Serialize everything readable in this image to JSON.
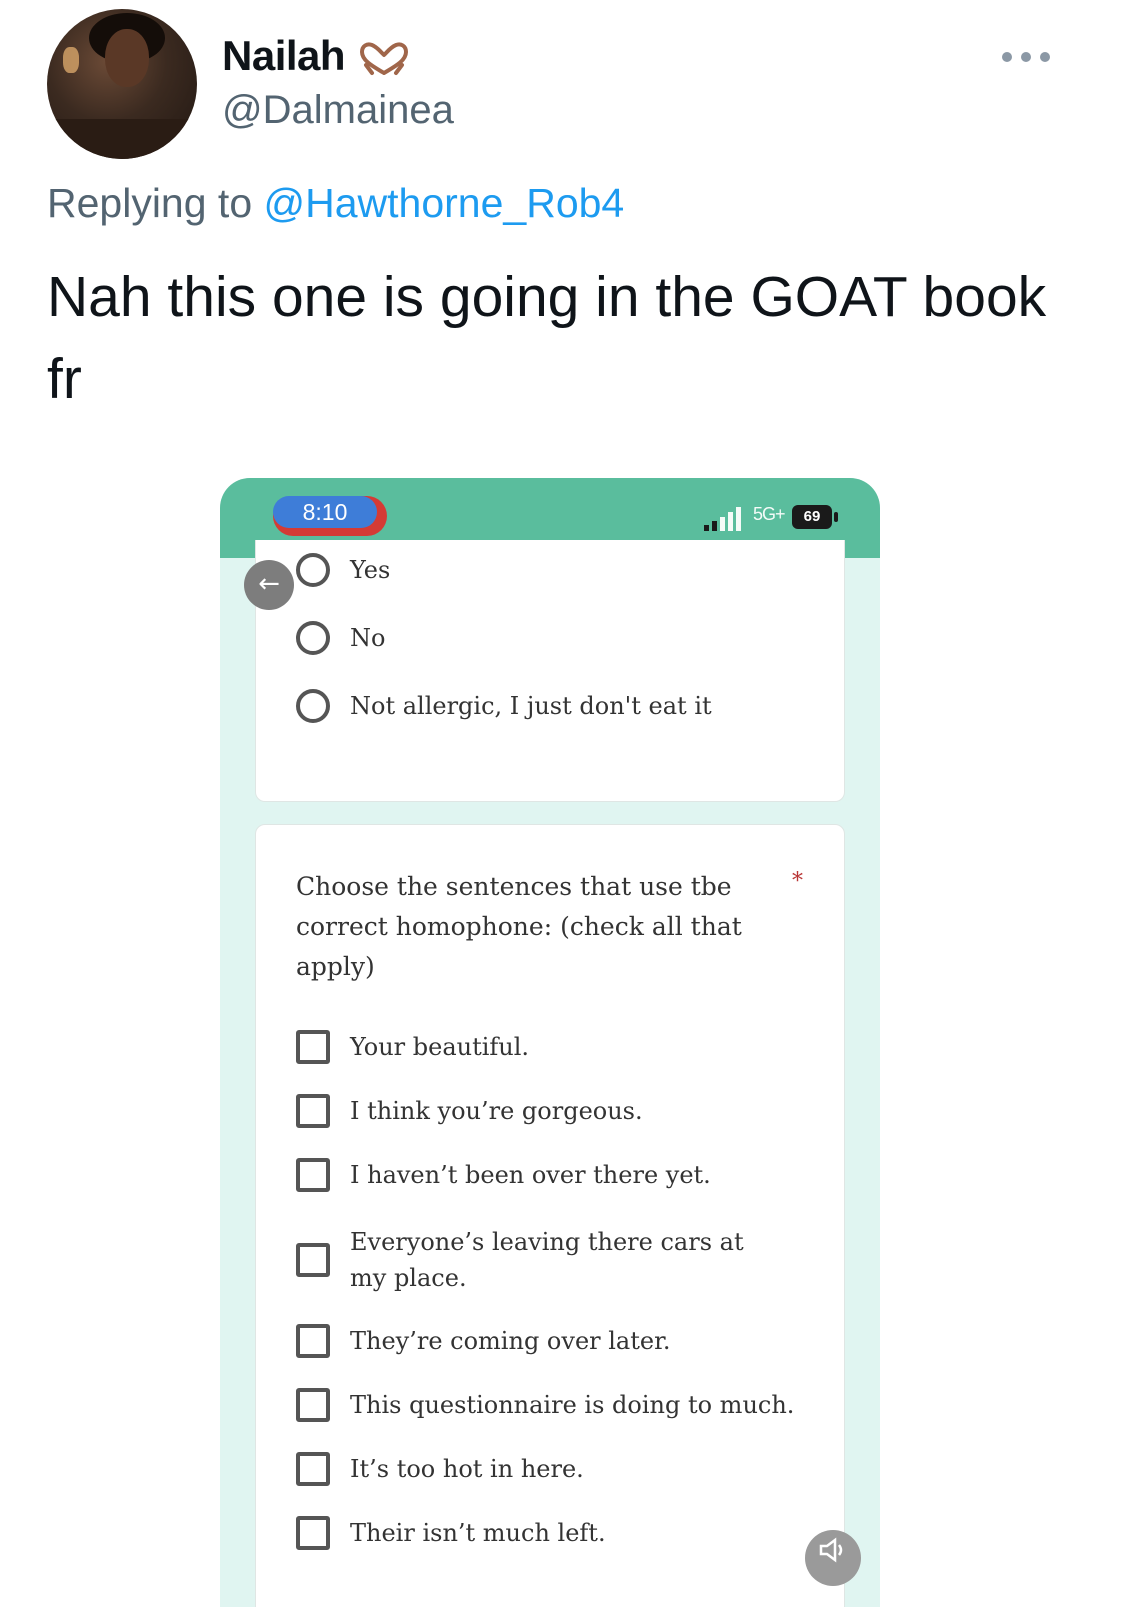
{
  "tweet": {
    "author_name": "Nailah",
    "author_handle": "@Dalmainea",
    "replying_prefix": "Replying to ",
    "replying_to": "@Hawthorne_Rob4",
    "text": "Nah this one is going in the GOAT book fr"
  },
  "media": {
    "status_bar": {
      "time": "8:10",
      "network": "5G+",
      "battery": "69"
    },
    "card1": {
      "options": [
        "Yes",
        "No",
        "Not allergic, I just don't eat it"
      ]
    },
    "card2": {
      "question": "Choose the sentences that use tbe correct homophone: (check all that apply)",
      "required_mark": "*",
      "options": [
        "Your beautiful.",
        "I think you’re gorgeous.",
        "I haven’t been over there yet.",
        "Everyone’s leaving there cars at my place.",
        "They’re coming over later.",
        "This questionnaire is doing to much.",
        "It’s too hot in here.",
        "Their isn’t much left."
      ]
    },
    "icons": {
      "back": "left-arrow-icon",
      "sound": "speaker-icon",
      "emoji": "heart-hands-icon",
      "more": "more-icon"
    },
    "colors": {
      "status_bar": "#5abd9d",
      "link": "#1d9bf0",
      "secondary_text": "#536471"
    }
  }
}
